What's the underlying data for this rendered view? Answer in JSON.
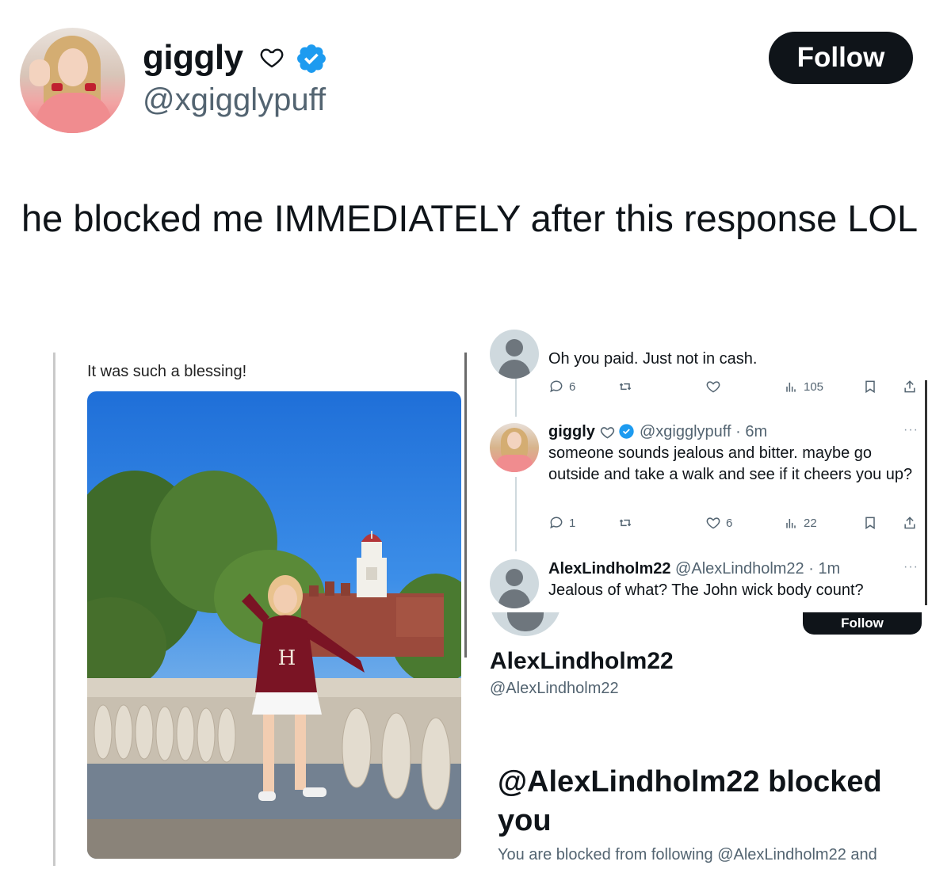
{
  "tweet": {
    "author": {
      "name": "giggly",
      "handle": "@xgigglypuff",
      "verified": true
    },
    "follow_label": "Follow",
    "text": "he blocked me IMMEDIATELY after this response LOL"
  },
  "screenshot": {
    "left_caption": "It was such a blessing!",
    "thread": [
      {
        "text": "Oh you paid. Just not in cash.",
        "stats": {
          "replies": "6",
          "likes": "",
          "views": "105"
        }
      },
      {
        "name": "giggly",
        "handle_time": "@xgigglypuff · 6m",
        "text": "someone sounds jealous and bitter. maybe go outside and take a walk and see if it cheers you up?",
        "stats": {
          "replies": "1",
          "likes": "6",
          "views": "22"
        }
      },
      {
        "name": "AlexLindholm22",
        "handle_time": "@AlexLindholm22 · 1m",
        "text": "Jealous of what? The John wick body count?"
      }
    ],
    "profile": {
      "follow_label": "Follow",
      "name": "AlexLindholm22",
      "handle": "@AlexLindholm22",
      "blocked_title": "@AlexLindholm22 blocked you",
      "blocked_desc": "You are blocked from following @AlexLindholm22 and"
    }
  },
  "colors": {
    "verified_blue": "#1d9bf0",
    "text_primary": "#0f1419",
    "text_secondary": "#536471",
    "button_dark": "#0f1419"
  }
}
